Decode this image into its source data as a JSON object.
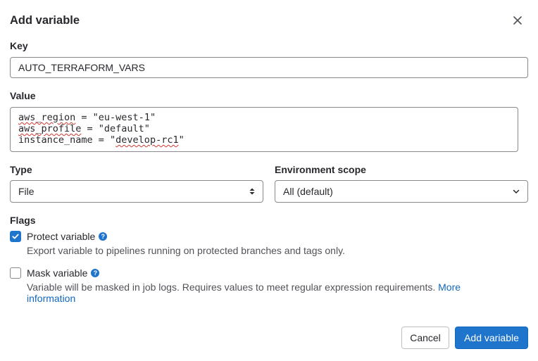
{
  "modal": {
    "title": "Add variable",
    "close_icon": "close-icon"
  },
  "key": {
    "label": "Key",
    "value": "AUTO_TERRAFORM_VARS"
  },
  "value_field": {
    "label": "Value",
    "lines": [
      {
        "before": "",
        "squiggle": "aws_region",
        "after": " = \"eu-west-1\""
      },
      {
        "before": "",
        "squiggle": "aws_profile",
        "after": " = \"default\""
      },
      {
        "before": "instance_name = \"",
        "squiggle": "develop-rc1",
        "after": "\""
      }
    ]
  },
  "type": {
    "label": "Type",
    "selected": "File",
    "icon": "sort-arrows-icon"
  },
  "environment_scope": {
    "label": "Environment scope",
    "selected": "All (default)",
    "icon": "chevron-down-icon"
  },
  "flags": {
    "label": "Flags",
    "protect": {
      "label": "Protect variable",
      "checked": true,
      "help_icon": "?",
      "description": "Export variable to pipelines running on protected branches and tags only."
    },
    "mask": {
      "label": "Mask variable",
      "checked": false,
      "help_icon": "?",
      "description": "Variable will be masked in job logs. Requires values to meet regular expression requirements.",
      "link_text_1": "More",
      "link_text_2": "information"
    }
  },
  "buttons": {
    "cancel": "Cancel",
    "add": "Add variable"
  },
  "colors": {
    "primary": "#1f75cb",
    "link": "#1068bf",
    "text": "#28272d",
    "border": "#89888d"
  }
}
